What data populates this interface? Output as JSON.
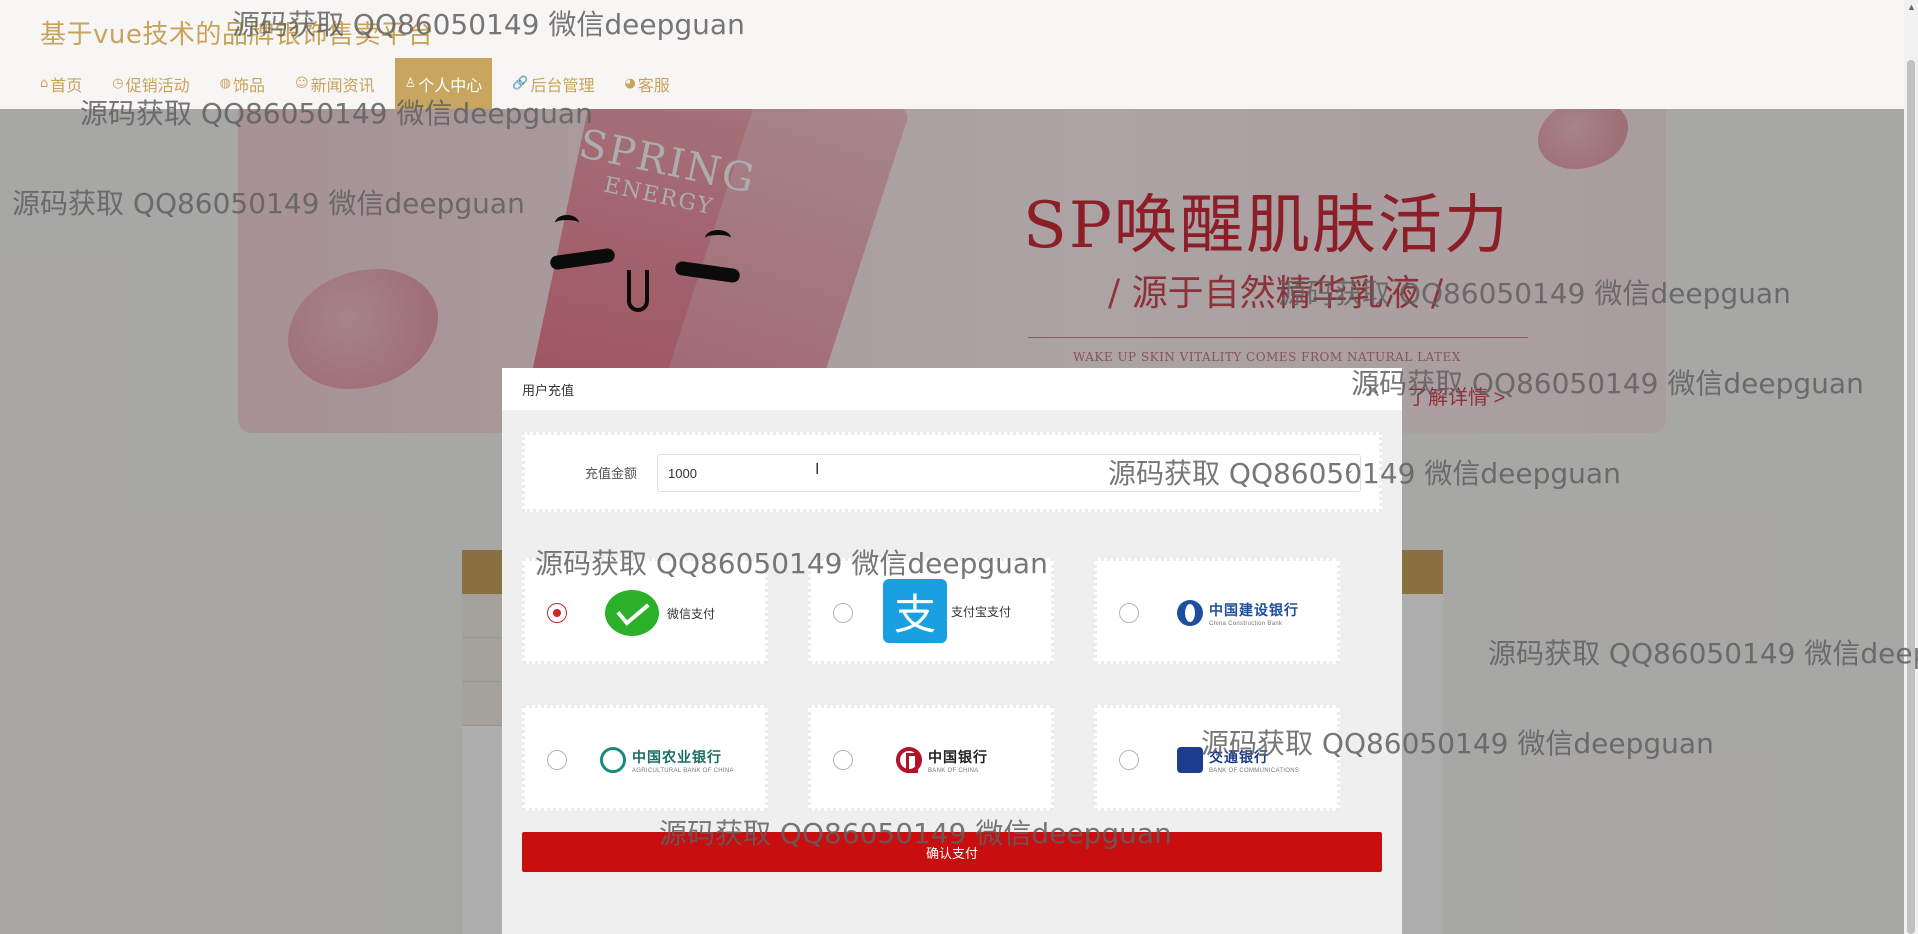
{
  "header": {
    "site_title": "基于vue技术的品牌银饰售卖平台",
    "nav": [
      {
        "icon": "⌂",
        "icon_name": "home-icon",
        "label": "首页",
        "active": false
      },
      {
        "icon": "◷",
        "icon_name": "clock-icon",
        "label": "促销活动",
        "active": false
      },
      {
        "icon": "◍",
        "icon_name": "goods-icon",
        "label": "饰品",
        "active": false
      },
      {
        "icon": "☺",
        "icon_name": "news-icon",
        "label": "新闻资讯",
        "active": false
      },
      {
        "icon": "♙",
        "icon_name": "user-icon",
        "label": "个人中心",
        "active": true
      },
      {
        "icon": "🔗",
        "icon_name": "link-icon",
        "label": "后台管理",
        "active": false
      },
      {
        "icon": "◕",
        "icon_name": "service-icon",
        "label": "客服",
        "active": false
      }
    ]
  },
  "banner": {
    "title": "SP唤醒肌肤活力",
    "subtitle": "/ 源于自然精华乳液 /",
    "english": "WAKE UP SKIN VITALITY COMES FROM NATURAL LATEX",
    "link": "了解详情 >",
    "product_text": "SPRING",
    "product_sub": "ENERGY"
  },
  "modal": {
    "title": "用户充值",
    "close": "×",
    "amount_label": "充值金额",
    "amount_value": "1000",
    "amount_arrow": "⌄",
    "payment_methods": [
      {
        "name": "微信支付",
        "type": "wechat",
        "checked": true
      },
      {
        "name": "支付宝支付",
        "type": "alipay",
        "logo_char": "支",
        "checked": false
      },
      {
        "name": "中国建设银行",
        "en": "China Construction Bank",
        "type": "ccb",
        "color": "#1d4f9e",
        "checked": false
      },
      {
        "name": "中国农业银行",
        "en": "AGRICULTURAL BANK OF CHINA",
        "type": "abc",
        "color": "#1a8b7a",
        "checked": false
      },
      {
        "name": "中国银行",
        "en": "BANK OF CHINA",
        "type": "boc",
        "color": "#b3122a",
        "checked": false
      },
      {
        "name": "交通银行",
        "en": "BANK OF COMMUNICATIONS",
        "type": "bocom",
        "color": "#1d3c8e",
        "checked": false
      }
    ],
    "confirm_label": "确认支付"
  },
  "watermark_text": "源码获取 QQ86050149 微信deepguan",
  "colors": {
    "accent": "#c9a660",
    "confirm": "#c80e0e",
    "wechat": "#2bb02a",
    "alipay": "#1a9fe0"
  }
}
